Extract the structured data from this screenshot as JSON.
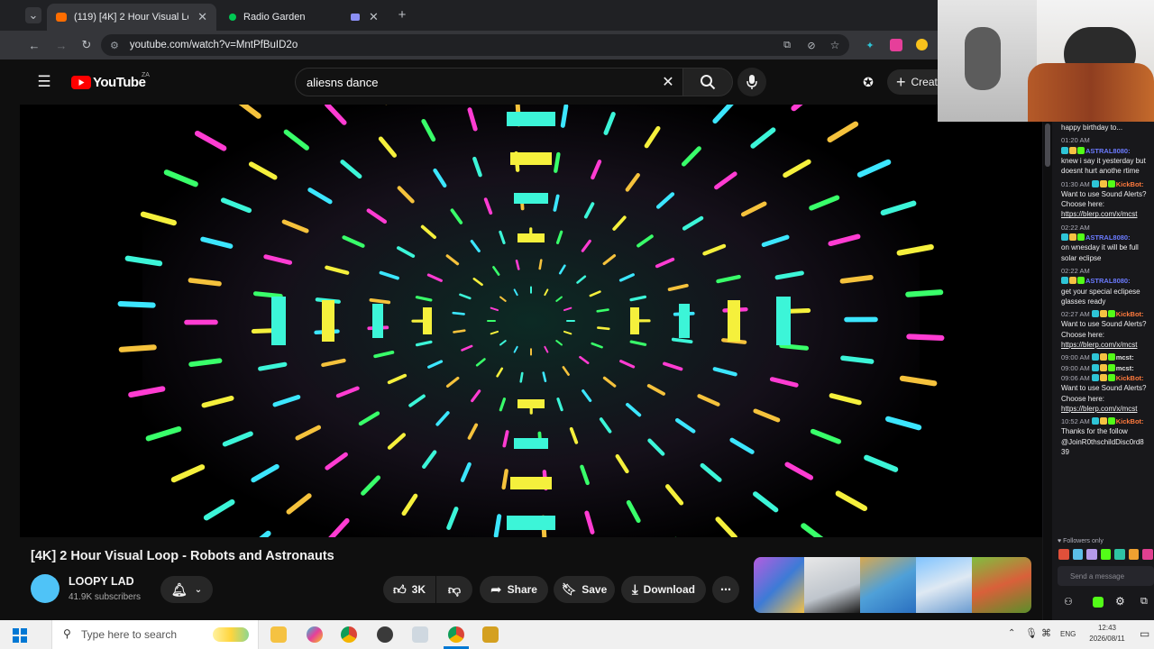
{
  "browser": {
    "tabs": [
      {
        "label": "(119) [4K] 2 Hour Visual Loop",
        "favicon_color": "#ff6d00"
      },
      {
        "label": "Radio Garden",
        "favicon_color": "#00c853"
      }
    ],
    "url": "youtube.com/watch?v=MntPfBuID2o"
  },
  "youtube": {
    "logo_text": "YouTube",
    "region": "ZA",
    "search_value": "aliesns dance",
    "create_label": "Create",
    "video_title": "[4K] 2 Hour Visual Loop - Robots and Astronauts",
    "channel_name": "LOOPY LAD",
    "subscribers": "41.9K subscribers",
    "likes": "3K",
    "share_label": "Share",
    "save_label": "Save",
    "download_label": "Download"
  },
  "chat": {
    "messages": [
      {
        "time": "",
        "user": "",
        "user_color": "",
        "text": "happy birthday to..."
      },
      {
        "time": "01:20 AM",
        "user": "",
        "user_color": "",
        "text": ""
      },
      {
        "time": "",
        "user": "ASTRAL8080:",
        "user_color": "#6b7bff",
        "text": ""
      },
      {
        "time": "",
        "user": "",
        "user_color": "",
        "text": "knew i say it yesterday but"
      },
      {
        "time": "",
        "user": "",
        "user_color": "",
        "text": "doesnt hurt anothe rtime"
      },
      {
        "time": "01:30 AM",
        "user": "KickBot:",
        "user_color": "#ff7a3d",
        "text": ""
      },
      {
        "time": "",
        "user": "",
        "user_color": "",
        "text": "Want to use Sound Alerts?"
      },
      {
        "time": "",
        "user": "",
        "user_color": "",
        "text": "Choose here:"
      },
      {
        "time": "",
        "user": "",
        "user_color": "",
        "text": "https://blerp.com/x/mcst",
        "link": true
      },
      {
        "time": "02:22 AM",
        "user": "",
        "user_color": "",
        "text": ""
      },
      {
        "time": "",
        "user": "ASTRAL8080:",
        "user_color": "#6b7bff",
        "text": ""
      },
      {
        "time": "",
        "user": "",
        "user_color": "",
        "text": "on wnesday it will be full"
      },
      {
        "time": "",
        "user": "",
        "user_color": "",
        "text": "solar eclipse"
      },
      {
        "time": "02:22 AM",
        "user": "",
        "user_color": "",
        "text": ""
      },
      {
        "time": "",
        "user": "ASTRAL8080:",
        "user_color": "#6b7bff",
        "text": ""
      },
      {
        "time": "",
        "user": "",
        "user_color": "",
        "text": "get your special eclipese"
      },
      {
        "time": "",
        "user": "",
        "user_color": "",
        "text": "glasses ready"
      },
      {
        "time": "02:27 AM",
        "user": "KickBot:",
        "user_color": "#ff7a3d",
        "text": ""
      },
      {
        "time": "",
        "user": "",
        "user_color": "",
        "text": "Want to use Sound Alerts?"
      },
      {
        "time": "",
        "user": "",
        "user_color": "",
        "text": "Choose here:"
      },
      {
        "time": "",
        "user": "",
        "user_color": "",
        "text": "https://blerp.com/x/mcst",
        "link": true
      },
      {
        "time": "09:00 AM",
        "user": "mcst:",
        "user_color": "#e0e0e0",
        "text": ""
      },
      {
        "time": "09:00 AM",
        "user": "mcst:",
        "user_color": "#e0e0e0",
        "text": ""
      },
      {
        "time": "09:06 AM",
        "user": "KickBot:",
        "user_color": "#ff7a3d",
        "text": ""
      },
      {
        "time": "",
        "user": "",
        "user_color": "",
        "text": "Want to use Sound Alerts?"
      },
      {
        "time": "",
        "user": "",
        "user_color": "",
        "text": "Choose here:"
      },
      {
        "time": "",
        "user": "",
        "user_color": "",
        "text": "https://blerp.com/x/mcst",
        "link": true
      },
      {
        "time": "10:52 AM",
        "user": "KickBot:",
        "user_color": "#ff7a3d",
        "text": ""
      },
      {
        "time": "",
        "user": "",
        "user_color": "",
        "text": "Thanks for the follow"
      },
      {
        "time": "",
        "user": "",
        "user_color": "",
        "text": "@JoinR0thschildDisc0rd8"
      },
      {
        "time": "",
        "user": "",
        "user_color": "",
        "text": "39"
      }
    ],
    "followers_only": "Followers only",
    "input_placeholder": "Send a message"
  },
  "taskbar": {
    "search_placeholder": "Type here to search",
    "language": "ENG",
    "time": "12:43",
    "date": "2026/08/11"
  },
  "colors": {
    "youtube_red": "#ff0000",
    "chat_bg": "#18181b",
    "kick_green": "#53fc18"
  }
}
